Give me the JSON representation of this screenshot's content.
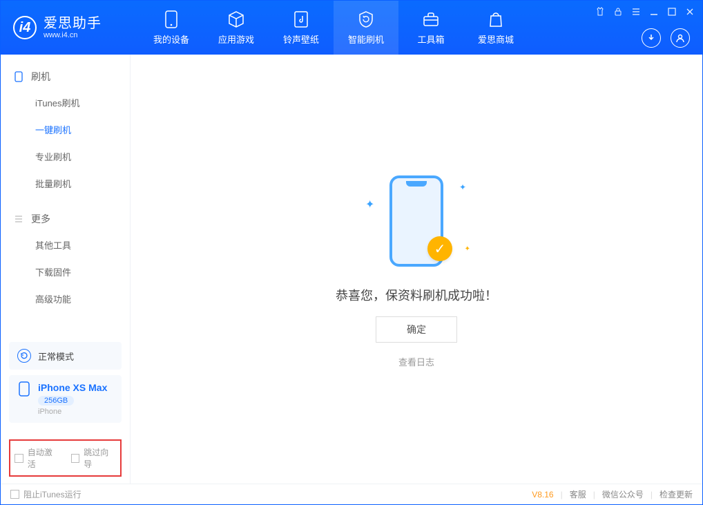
{
  "app": {
    "title": "爱思助手",
    "subtitle": "www.i4.cn"
  },
  "nav": {
    "items": [
      {
        "label": "我的设备"
      },
      {
        "label": "应用游戏"
      },
      {
        "label": "铃声壁纸"
      },
      {
        "label": "智能刷机"
      },
      {
        "label": "工具箱"
      },
      {
        "label": "爱思商城"
      }
    ]
  },
  "sidebar": {
    "section1_title": "刷机",
    "section1_items": [
      {
        "label": "iTunes刷机"
      },
      {
        "label": "一键刷机"
      },
      {
        "label": "专业刷机"
      },
      {
        "label": "批量刷机"
      }
    ],
    "section2_title": "更多",
    "section2_items": [
      {
        "label": "其他工具"
      },
      {
        "label": "下载固件"
      },
      {
        "label": "高级功能"
      }
    ],
    "mode_label": "正常模式",
    "device": {
      "name": "iPhone XS Max",
      "capacity": "256GB",
      "type": "iPhone"
    },
    "opts": {
      "auto_activate": "自动激活",
      "skip_guide": "跳过向导"
    }
  },
  "main": {
    "success_text": "恭喜您，保资料刷机成功啦！",
    "ok_label": "确定",
    "log_link": "查看日志"
  },
  "footer": {
    "block_itunes": "阻止iTunes运行",
    "version": "V8.16",
    "links": {
      "service": "客服",
      "wechat": "微信公众号",
      "update": "检查更新"
    }
  }
}
